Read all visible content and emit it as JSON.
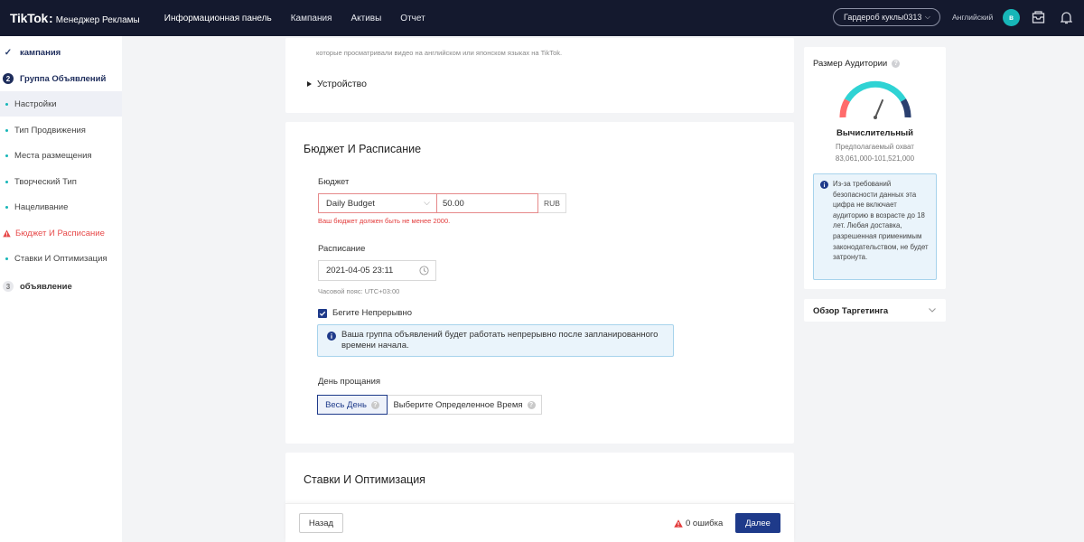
{
  "topbar": {
    "logo": "TikTok",
    "logo_sep": ":",
    "logo_sub": "Менеджер Рекламы",
    "nav": [
      "Информационная панель",
      "Кампания",
      "Активы",
      "Отчет"
    ],
    "account": "Гардероб куклы0313",
    "language": "Английский",
    "avatar_letter": "в"
  },
  "sidebar": {
    "step1": {
      "num": "✓",
      "label": "кампания"
    },
    "step2": {
      "num": "2",
      "label": "Группа Объявлений"
    },
    "items": [
      "Настройки",
      "Тип Продвижения",
      "Места размещения",
      "Творческий Тип",
      "Нацеливание",
      "Бюджет И Расписание",
      "Ставки И Оптимизация"
    ],
    "step3": {
      "num": "3",
      "label": "объявление"
    }
  },
  "top_card": {
    "note": "которые просматривали видео на английском или японском языках на TikTok.",
    "device": "Устройство"
  },
  "budget_section": {
    "title": "Бюджет И Расписание",
    "budget_label": "Бюджет",
    "budget_type": "Daily Budget",
    "budget_value": "50.00",
    "currency": "RUB",
    "budget_error": "Ваш бюджет должен быть не менее 2000.",
    "schedule_label": "Расписание",
    "schedule_date": "2021-04-05 23:11",
    "timezone": "Часовой пояс: UTC+03:00",
    "continuous_label": "Бегите Непрерывно",
    "continuous_checked": true,
    "info_text": "Ваша группа объявлений будет работать непрерывно после запланированного времени начала.",
    "dayparting_label": "День прощания",
    "option_all_day": "Весь День",
    "option_specific": "Выберите Определенное Время"
  },
  "bid_section": {
    "title": "Ставки И Оптимизация"
  },
  "footer": {
    "back": "Назад",
    "errors": "0 ошибка",
    "next": "Далее"
  },
  "audience": {
    "title": "Размер Аудитории",
    "gauge_label": "Вычислительный",
    "reach_label": "Предполагаемый охват",
    "reach_value": "83,061,000-101,521,000",
    "note": "Из-за требований безопасности данных эта цифра не включает аудиторию в возрасте до 18 лет. Любая доставка, разрешенная применимым законодательством, не будет затронута."
  },
  "targeting": {
    "title": "Обзор Таргетинга"
  },
  "colors": {
    "topbar": "#14192e",
    "accent": "#1e3a8a",
    "teal": "#17b6b8",
    "error": "#e33c3c"
  }
}
